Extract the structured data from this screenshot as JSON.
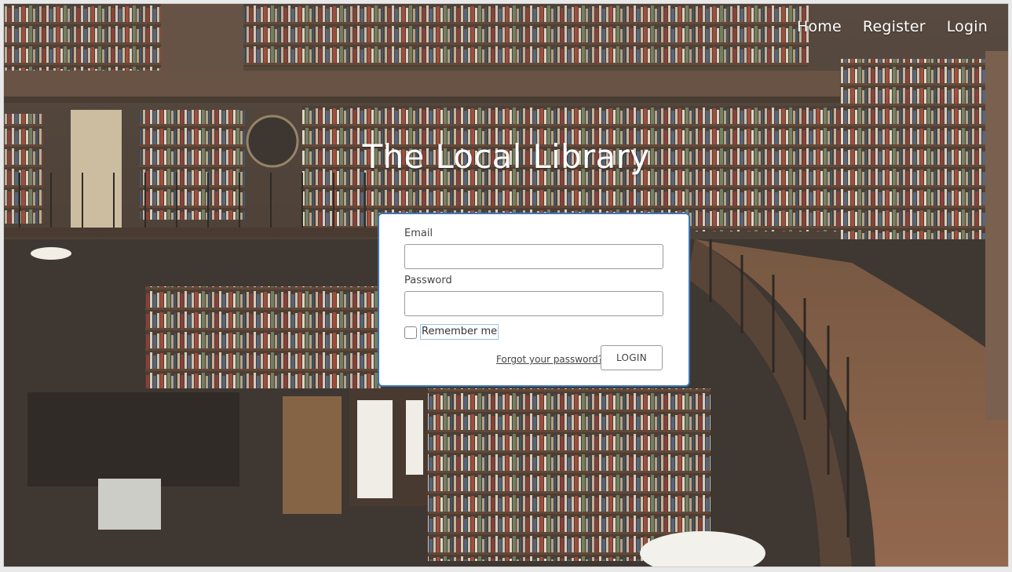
{
  "nav": {
    "home": "Home",
    "register": "Register",
    "login": "Login"
  },
  "page": {
    "title": "The Local Library"
  },
  "form": {
    "email_label": "Email",
    "email_value": "",
    "password_label": "Password",
    "password_value": "",
    "remember_label": "Remember me",
    "remember_checked": false,
    "forgot_link": "Forgot your password?",
    "login_button": "LOGIN"
  },
  "colors": {
    "card_border": "#3b74b8",
    "nav_text": "#ffffff",
    "title_text": "#ffffff"
  },
  "background": {
    "scene": "library-bookshelves-photo"
  }
}
